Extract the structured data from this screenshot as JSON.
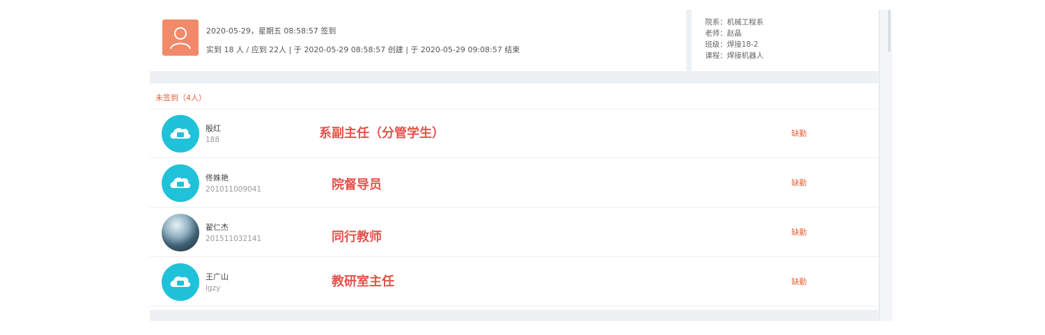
{
  "summary": {
    "line1": "2020-05-29，星期五 08:58:57 签到",
    "line2": "实到 18 人 / 应到 22人 | 于 2020-05-29 08:58:57 创建 | 于 2020-05-29 09:08:57 结束",
    "avatar_icon": "user-icon",
    "avatar_color": "#f08a6a"
  },
  "course_info": {
    "department": "院系：机械工程系",
    "teacher": "老师：赵晶",
    "class": "班级：焊接18-2",
    "course": "课程：焊接机器人"
  },
  "absent": {
    "title": "未签到（4人）",
    "status_color": "#e0643c",
    "people": [
      {
        "name": "殷红",
        "id": "188",
        "role_note": "系副主任（分管学生）",
        "status": "缺勤",
        "avatar": "cloud-icon"
      },
      {
        "name": "佟姝艳",
        "id": "201011009041",
        "role_note": "院督导员",
        "status": "缺勤",
        "avatar": "cloud-icon"
      },
      {
        "name": "翟仁杰",
        "id": "201511032141",
        "role_note": "同行教师",
        "status": "缺勤",
        "avatar": "photo"
      },
      {
        "name": "王广山",
        "id": "lgzy",
        "role_note": "教研室主任",
        "status": "缺勤",
        "avatar": "cloud-icon"
      }
    ]
  },
  "colors": {
    "accent_cyan": "#1fc2d8",
    "annotation_red": "#e4524b"
  }
}
